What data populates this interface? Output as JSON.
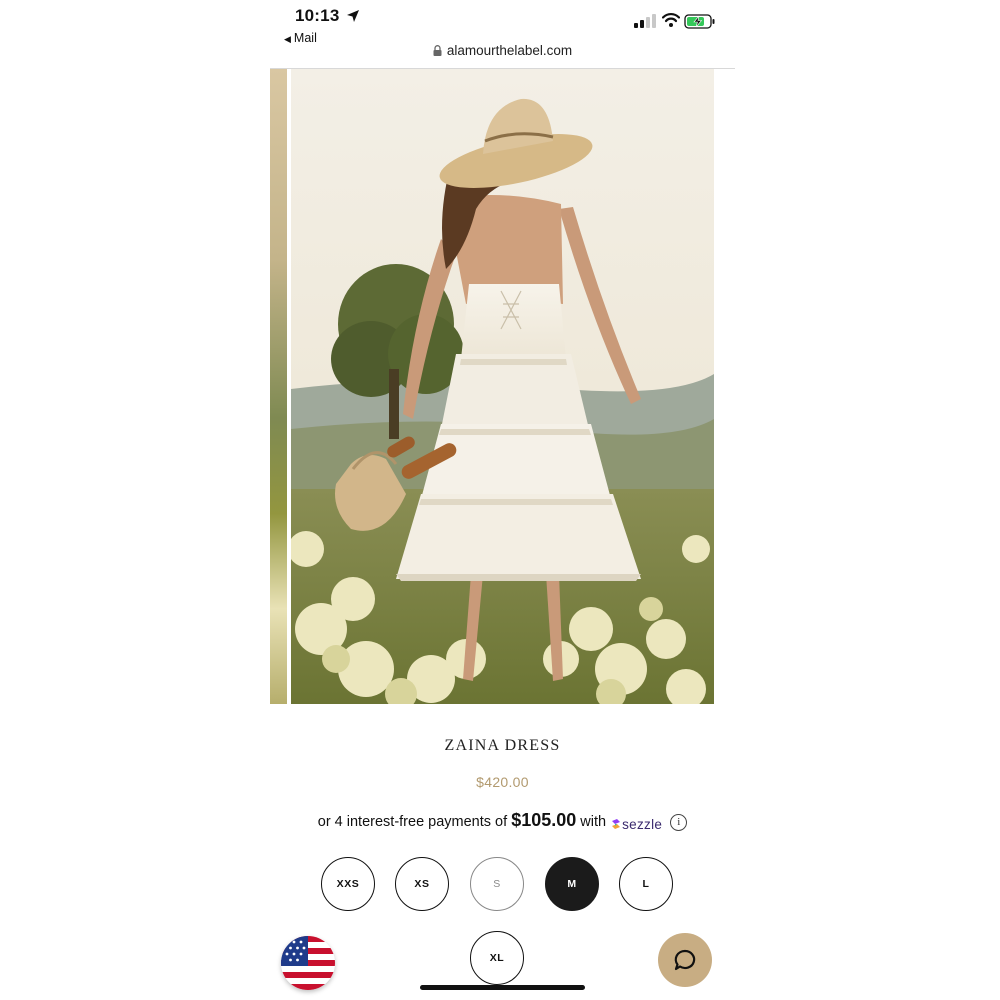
{
  "status_bar": {
    "time": "10:13",
    "back_label": "Mail",
    "icons": [
      "location-arrow-icon",
      "signal-icon",
      "wifi-icon",
      "battery-charging-icon"
    ]
  },
  "browser": {
    "url": "alamourthelabel.com",
    "lock_icon": "lock-icon"
  },
  "product": {
    "image_alt": "Model wearing white tiered lace halter dress in a hydrangea field",
    "title": "ZAINA DRESS",
    "price": "$420.00",
    "installments": {
      "prefix": "or 4 interest-free payments of",
      "amount": "$105.00",
      "connector": "with",
      "provider": "sezzle",
      "info_glyph": "i"
    }
  },
  "sizes": {
    "options": [
      {
        "label": "XXS",
        "state": "available"
      },
      {
        "label": "XS",
        "state": "available"
      },
      {
        "label": "S",
        "state": "unavailable"
      },
      {
        "label": "M",
        "state": "selected"
      },
      {
        "label": "L",
        "state": "available"
      },
      {
        "label": "XL",
        "state": "available"
      }
    ]
  },
  "footer": {
    "flag_icon": "us-flag-icon",
    "chat_icon": "chat-bubble-icon"
  },
  "colors": {
    "price": "#b29a6f",
    "chat_button": "#c8ad83",
    "selected_size": "#1b1b1b"
  }
}
